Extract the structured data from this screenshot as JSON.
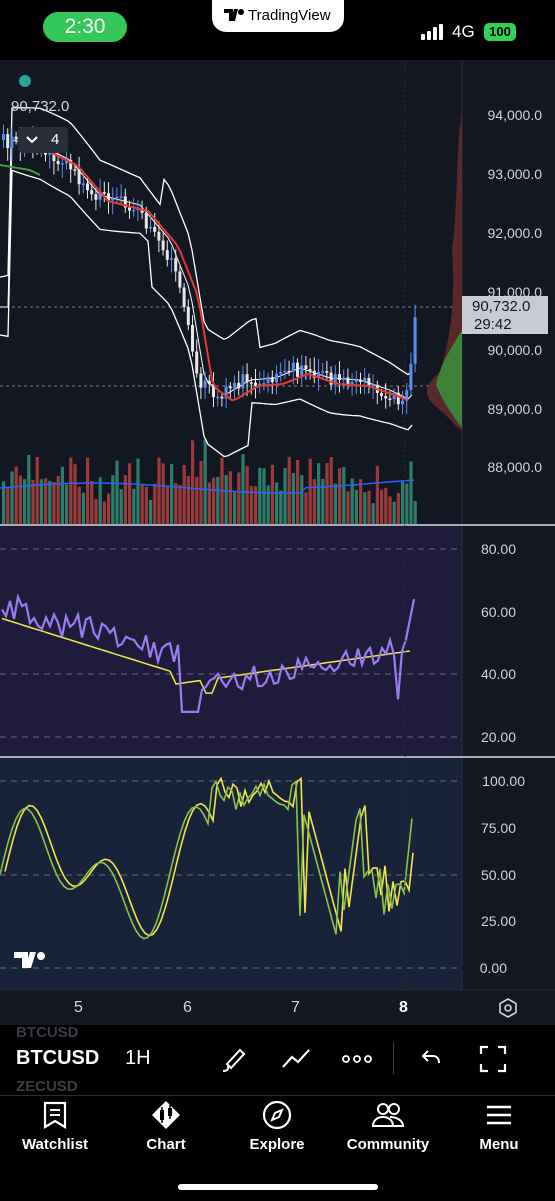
{
  "status_bar": {
    "time": "2:30",
    "app_banner": "TradingView",
    "network": "4G",
    "battery": "100"
  },
  "chart": {
    "current_price": "90,732.0",
    "countdown": "29:42",
    "indicator_count": "4",
    "price_axis": [
      "94,000.0",
      "93,000.0",
      "92,000.0",
      "91,000.0",
      "90,000.0",
      "89,000.0",
      "88,000.0"
    ],
    "rsi_axis": [
      "80.00",
      "60.00",
      "40.00",
      "20.00"
    ],
    "stoch_axis": [
      "100.00",
      "75.00",
      "50.00",
      "25.00",
      "0.00"
    ],
    "time_axis": [
      "5",
      "6",
      "7",
      "8"
    ],
    "colors": {
      "background": "#131722",
      "up": "#5b8def",
      "down": "#e8e8e8",
      "volume_up": "#2e7d6b",
      "volume_down": "#9b3a3a",
      "rsi": "#9b7bf0",
      "signal": "#f4e44c",
      "stoch_k": "#8bc34a",
      "stoch_d": "#f4e44c",
      "ma_red": "#e53935",
      "ma_green": "#43a047"
    }
  },
  "toolbar": {
    "symbol": "BTCUSD",
    "timeframe": "1H",
    "symbol_ghost_above": "BTCUSD",
    "symbol_ghost_below": "ZECUSD",
    "icons": [
      "brush-icon",
      "trend-line-icon",
      "more-icon",
      "undo-icon",
      "fullscreen-icon"
    ]
  },
  "tabs": [
    {
      "label": "Watchlist",
      "icon": "watchlist-icon"
    },
    {
      "label": "Chart",
      "icon": "chart-icon"
    },
    {
      "label": "Explore",
      "icon": "compass-icon"
    },
    {
      "label": "Community",
      "icon": "community-icon"
    },
    {
      "label": "Menu",
      "icon": "menu-icon"
    }
  ]
}
